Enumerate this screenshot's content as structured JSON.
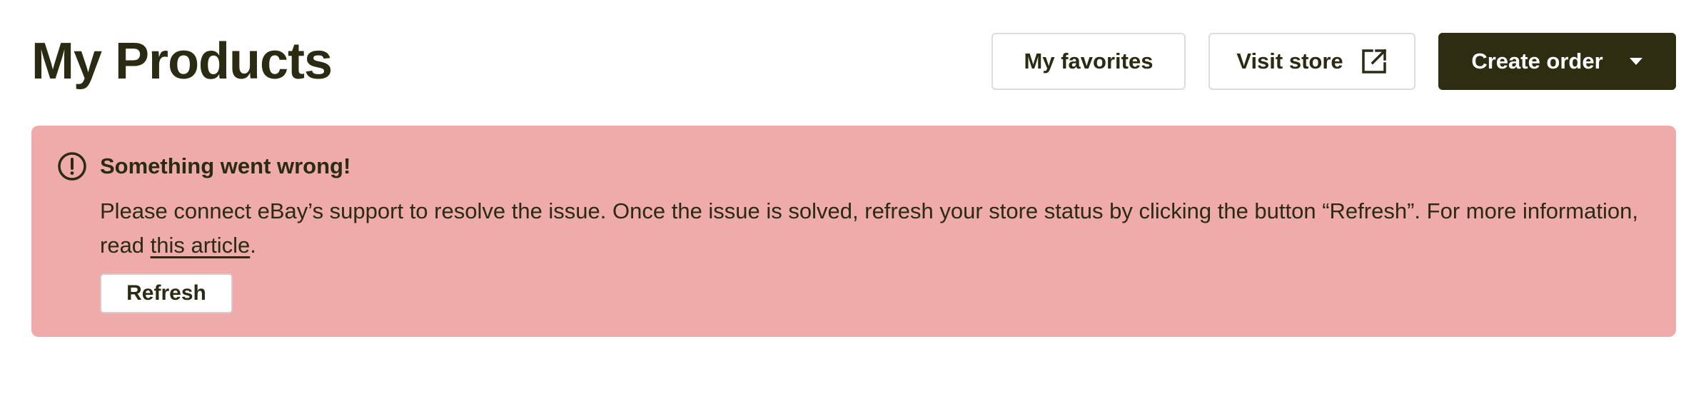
{
  "header": {
    "title": "My Products",
    "favorites_label": "My favorites",
    "visit_store_label": "Visit store",
    "create_order_label": "Create order"
  },
  "alert": {
    "title": "Something went wrong!",
    "message_before_link": "Please connect eBay’s support to resolve the issue. Once the issue is solved, refresh your store status by clicking the button “Refresh”. For more information, read ",
    "link_text": "this article",
    "message_after_link": ".",
    "refresh_label": "Refresh"
  },
  "icons": {
    "alert": "exclamation-circle-icon",
    "visit_store": "external-link-icon",
    "create_order": "caret-down-icon"
  },
  "colors": {
    "text": "#2b2a13",
    "primary_button": "#2e2d12",
    "alert_background": "#efaaaa",
    "button_border": "#dcdcdc"
  }
}
